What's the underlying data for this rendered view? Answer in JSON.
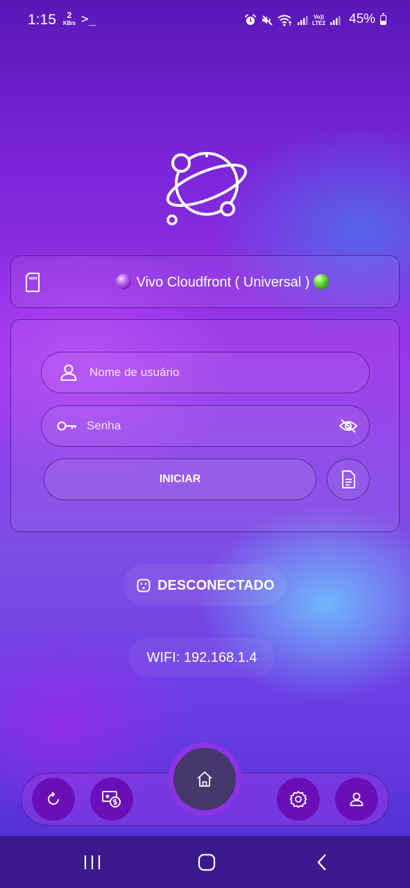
{
  "status_bar": {
    "time": "1:15",
    "network_speed_value": "2",
    "network_speed_unit": "KB/s",
    "terminal_glyph": ">_",
    "volte_label_top": "Vo))",
    "volte_label_bottom": "LTE2",
    "battery_text": "45%",
    "battery_level": 0.45,
    "icons": [
      "alarm-icon",
      "mute-icon",
      "wifi-icon",
      "signal-icon",
      "signal-icon",
      "battery-icon"
    ]
  },
  "server": {
    "name": "Vivo Cloudfront ( Universal )",
    "sim_icon": "sd-card-icon",
    "status_color": "#3ecf1f"
  },
  "login": {
    "username_placeholder": "Nome de usuário",
    "password_placeholder": "Senha",
    "start_label": "INICIAR",
    "icons": [
      "user-icon",
      "key-icon",
      "eye-off-icon",
      "document-icon"
    ]
  },
  "connection": {
    "status": "DESCONECTADO",
    "wifi": "WIFI: 192.168.1.4"
  },
  "bottom_nav": {
    "items": [
      "refresh-icon",
      "payment-icon",
      "home-icon",
      "settings-icon",
      "profile-icon"
    ],
    "active": "home-icon",
    "accent": "#6a0fb8"
  },
  "colors": {
    "background_top": "#5a17b8",
    "background_mid": "#9a36ea",
    "background_bottom": "#4e2ccf",
    "system_nav": "#3a1a8c"
  }
}
